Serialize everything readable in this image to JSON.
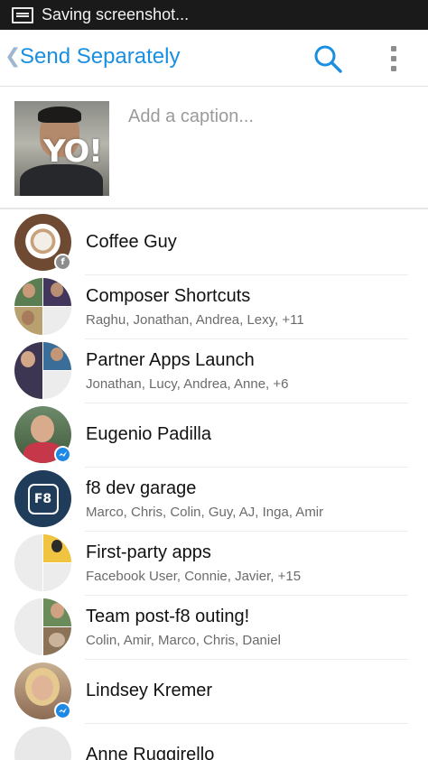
{
  "status_bar": {
    "text": "Saving screenshot..."
  },
  "app_bar": {
    "title": "Send Separately"
  },
  "caption": {
    "photo_text": "YO!",
    "placeholder": "Add a caption..."
  },
  "conversations": [
    {
      "name": "Coffee Guy",
      "subtitle": ""
    },
    {
      "name": "Composer Shortcuts",
      "subtitle": "Raghu, Jonathan, Andrea, Lexy, +11"
    },
    {
      "name": "Partner Apps Launch",
      "subtitle": "Jonathan, Lucy, Andrea, Anne, +6"
    },
    {
      "name": "Eugenio Padilla",
      "subtitle": ""
    },
    {
      "name": "f8 dev garage",
      "subtitle": "Marco, Chris, Colin, Guy, AJ, Inga, Amir",
      "avatar_text": "F8"
    },
    {
      "name": "First-party apps",
      "subtitle": "Facebook User, Connie, Javier, +15"
    },
    {
      "name": "Team post-f8 outing!",
      "subtitle": "Colin, Amir, Marco, Chris, Daniel"
    },
    {
      "name": "Lindsey Kremer",
      "subtitle": ""
    },
    {
      "name": "Anne Ruggirello",
      "subtitle": ""
    }
  ],
  "colors": {
    "accent": "#1a8fe0",
    "status_bar": "#1a1a1a",
    "messenger_badge": "#1e88e5",
    "f8_avatar": "#1f3c5a"
  },
  "icons": {
    "back": "chevron-left-icon",
    "search": "search-icon",
    "overflow": "overflow-menu-icon",
    "facebook_badge": "facebook-icon",
    "messenger_badge": "messenger-icon"
  }
}
